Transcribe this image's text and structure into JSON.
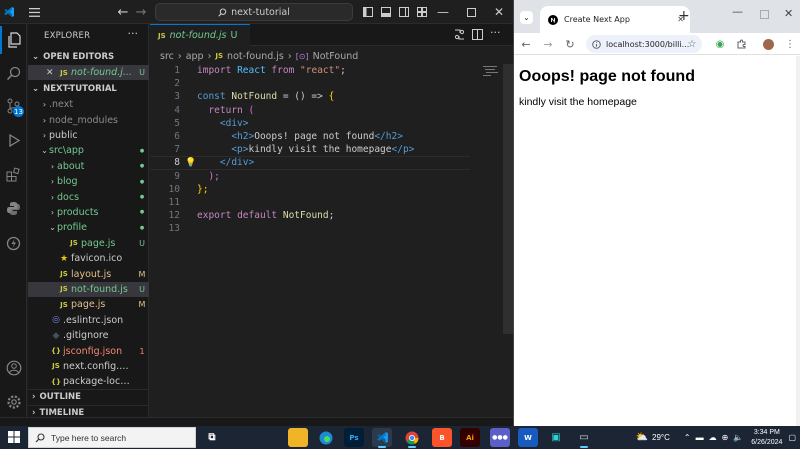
{
  "vscode": {
    "command_center": "next-tutorial",
    "explorer_title": "EXPLORER",
    "open_editors_header": "OPEN EDITORS",
    "open_editor": {
      "name": "not-found.j...",
      "status": "U"
    },
    "project_header": "NEXT-TUTORIAL",
    "tree": [
      {
        "name": ".next",
        "type": "folder",
        "open": false,
        "indent": 1,
        "status": "",
        "color": "#8b8b8b"
      },
      {
        "name": "node_modules",
        "type": "folder",
        "open": false,
        "indent": 1,
        "status": "",
        "color": "#8b8b8b"
      },
      {
        "name": "public",
        "type": "folder",
        "open": false,
        "indent": 1,
        "status": "",
        "color": "#cccccc"
      },
      {
        "name": "src\\app",
        "type": "folder",
        "open": true,
        "indent": 1,
        "status": "dot",
        "color": "#73c991"
      },
      {
        "name": "about",
        "type": "folder",
        "open": false,
        "indent": 2,
        "status": "dot",
        "color": "#73c991"
      },
      {
        "name": "blog",
        "type": "folder",
        "open": false,
        "indent": 2,
        "status": "dot",
        "color": "#73c991"
      },
      {
        "name": "docs",
        "type": "folder",
        "open": false,
        "indent": 2,
        "status": "dot",
        "color": "#73c991"
      },
      {
        "name": "products",
        "type": "folder",
        "open": false,
        "indent": 2,
        "status": "dot",
        "color": "#73c991"
      },
      {
        "name": "profile",
        "type": "folder",
        "open": true,
        "indent": 2,
        "status": "dot",
        "color": "#73c991"
      },
      {
        "name": "page.js",
        "type": "js",
        "indent": 3,
        "status": "U",
        "color": "#73c991"
      },
      {
        "name": "favicon.ico",
        "type": "star",
        "indent": 2,
        "status": "",
        "color": "#cccccc"
      },
      {
        "name": "layout.js",
        "type": "js",
        "indent": 2,
        "status": "M",
        "color": "#e2c08d"
      },
      {
        "name": "not-found.js",
        "type": "js",
        "indent": 2,
        "status": "U",
        "color": "#73c991",
        "selected": true
      },
      {
        "name": "page.js",
        "type": "js",
        "indent": 2,
        "status": "M",
        "color": "#e2c08d"
      },
      {
        "name": ".eslintrc.json",
        "type": "eslint",
        "indent": 1,
        "status": "",
        "color": "#cccccc"
      },
      {
        "name": ".gitignore",
        "type": "git",
        "indent": 1,
        "status": "",
        "color": "#cccccc"
      },
      {
        "name": "jsconfig.json",
        "type": "json",
        "indent": 1,
        "status": "1",
        "color": "#f48771"
      },
      {
        "name": "next.config.mjs",
        "type": "js",
        "indent": 1,
        "status": "",
        "color": "#cccccc"
      },
      {
        "name": "package-lock.json",
        "type": "json",
        "indent": 1,
        "status": "",
        "color": "#cccccc"
      }
    ],
    "outline_header": "OUTLINE",
    "timeline_header": "TIMELINE",
    "tab": {
      "name": "not-found.js",
      "status": "U"
    },
    "breadcrumb": [
      "src",
      "app",
      "not-found.js",
      "NotFound"
    ],
    "code_lines": [
      "1",
      "2",
      "3",
      "4",
      "5",
      "6",
      "7",
      "8",
      "9",
      "10",
      "11",
      "12",
      "13"
    ],
    "code": {
      "l1_import": "import",
      "l1_react": "React",
      "l1_from": "from",
      "l1_str": "\"react\"",
      "l1_semi": ";",
      "l3_const": "const",
      "l3_name": "NotFound",
      "l3_rest": " = () => ",
      "l4_return": "return",
      "l4_paren": "(",
      "l5_div": "<div>",
      "l6_open": "<h2>",
      "l6_text": "Ooops! page not found",
      "l6_close": "</h2>",
      "l7_open": "<p>",
      "l7_text": "kindly visit the homepage",
      "l7_close": "</p>",
      "l8_close": "</div>",
      "l9": ");",
      "l10": "};",
      "l12_export": "export",
      "l12_default": "default",
      "l12_name": "NotFound",
      "l12_semi": ";"
    }
  },
  "browser": {
    "tab_title": "Create Next App",
    "url": "localhost:3000/billi...",
    "heading": "Ooops! page not found",
    "paragraph": "kindly visit the homepage"
  },
  "taskbar": {
    "search_placeholder": "Type here to search",
    "weather": "29°C",
    "time": "3:34 PM",
    "date": "6/26/2024"
  }
}
